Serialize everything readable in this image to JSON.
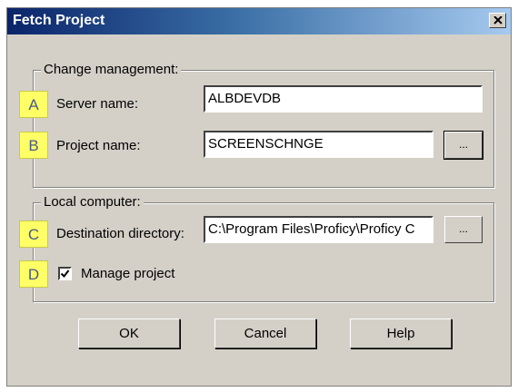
{
  "window": {
    "title": "Fetch Project"
  },
  "change_management": {
    "label": "Change management:",
    "server_badge": "A",
    "server_label": "Server name:",
    "server_value": "ALBDEVDB",
    "project_badge": "B",
    "project_label": "Project name:",
    "project_value": "SCREENSCHNGE",
    "browse_label": "..."
  },
  "local_computer": {
    "label": "Local computer:",
    "destination_badge": "C",
    "destination_label": "Destination directory:",
    "destination_value": "C:\\Program Files\\Proficy\\Proficy C",
    "browse_label": "...",
    "manage_badge": "D",
    "manage_label": "Manage project",
    "manage_checked": true
  },
  "buttons": {
    "ok": "OK",
    "cancel": "Cancel",
    "help": "Help"
  },
  "icons": {
    "close": "close-icon",
    "checkmark": "checkmark-icon"
  }
}
